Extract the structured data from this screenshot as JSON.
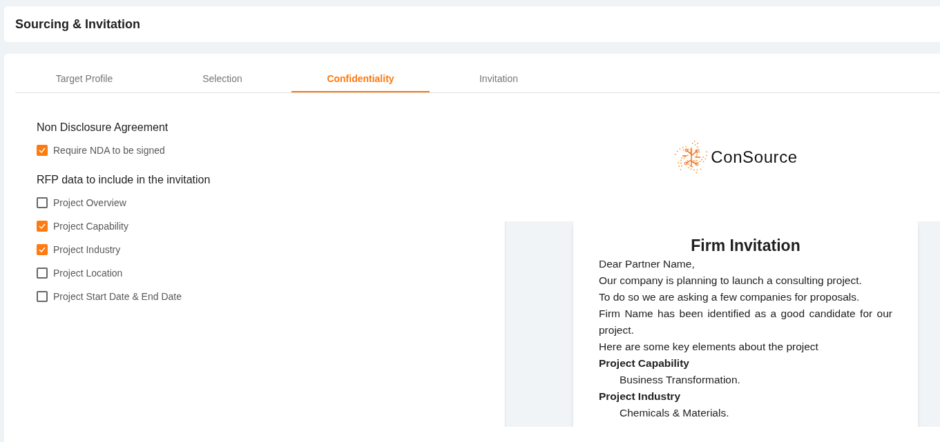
{
  "header": {
    "title": "Sourcing & Invitation"
  },
  "tabs": [
    {
      "label": "Target Profile",
      "selected": false
    },
    {
      "label": "Selection",
      "selected": false
    },
    {
      "label": "Confidentiality",
      "selected": true
    },
    {
      "label": "Invitation",
      "selected": false
    }
  ],
  "nda": {
    "heading": "Non Disclosure Agreement",
    "options": [
      {
        "label": "Require NDA to be signed",
        "checked": true
      }
    ]
  },
  "rfp_data": {
    "heading": "RFP data to include in the invitation",
    "options": [
      {
        "label": "Project Overview",
        "checked": false
      },
      {
        "label": "Project Capability",
        "checked": true
      },
      {
        "label": "Project Industry",
        "checked": true
      },
      {
        "label": "Project Location",
        "checked": false
      },
      {
        "label": "Project Start Date & End Date",
        "checked": false
      }
    ]
  },
  "preview": {
    "logo_text": "ConSource",
    "title": "Firm Invitation",
    "lines": [
      {
        "kind": "text",
        "text": "Dear Partner Name,"
      },
      {
        "kind": "text",
        "text": "Our company is planning to launch a consulting project."
      },
      {
        "kind": "text",
        "text": "To do so we are asking a few companies for proposals."
      },
      {
        "kind": "text",
        "text": "Firm Name has been identified as a good candidate for our project."
      },
      {
        "kind": "text",
        "text": "Here are some key elements about the project"
      },
      {
        "kind": "label",
        "text": "Project Capability"
      },
      {
        "kind": "value",
        "text": "Business Transformation."
      },
      {
        "kind": "label",
        "text": "Project Industry"
      },
      {
        "kind": "value",
        "text": "Chemicals & Materials."
      }
    ]
  }
}
